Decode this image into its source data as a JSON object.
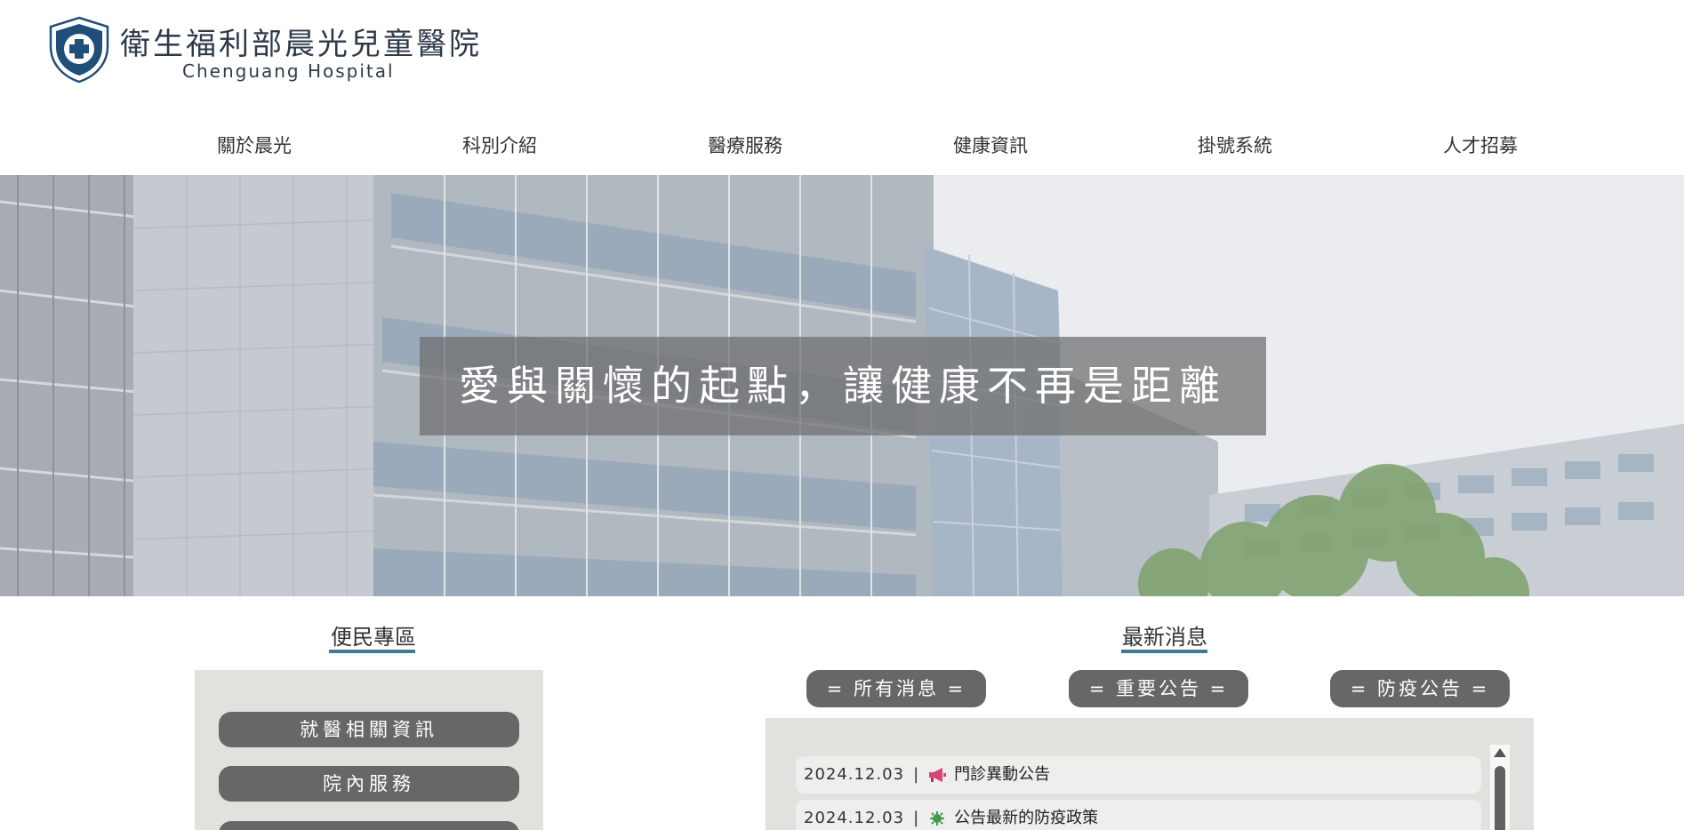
{
  "header": {
    "title": "衛生福利部晨光兒童醫院",
    "subtitle": "Chenguang Hospital"
  },
  "nav": {
    "items": [
      {
        "label": "關於晨光"
      },
      {
        "label": "科別介紹"
      },
      {
        "label": "醫療服務"
      },
      {
        "label": "健康資訊"
      },
      {
        "label": "掛號系統"
      },
      {
        "label": "人才招募"
      }
    ]
  },
  "hero": {
    "caption": "愛與關懷的起點，讓健康不再是距離"
  },
  "services": {
    "title": "便民專區",
    "buttons": [
      {
        "label": "就醫相關資訊"
      },
      {
        "label": "院內服務"
      },
      {
        "label": ""
      }
    ]
  },
  "news": {
    "title": "最新消息",
    "tabs": [
      {
        "label": "= 所有消息 ="
      },
      {
        "label": "= 重要公告 ="
      },
      {
        "label": "= 防疫公告 ="
      }
    ],
    "items": [
      {
        "date": "2024.12.03",
        "separator": "|",
        "icon": "megaphone-icon",
        "title": "門診異動公告"
      },
      {
        "date": "2024.12.03",
        "separator": "|",
        "icon": "virus-icon",
        "title": "公告最新的防疫政策"
      }
    ]
  },
  "colors": {
    "accent": "#3f7d8c",
    "button_bg": "#676767",
    "panel_bg": "#e3e1dd",
    "logo_navy": "#1f4e79"
  }
}
